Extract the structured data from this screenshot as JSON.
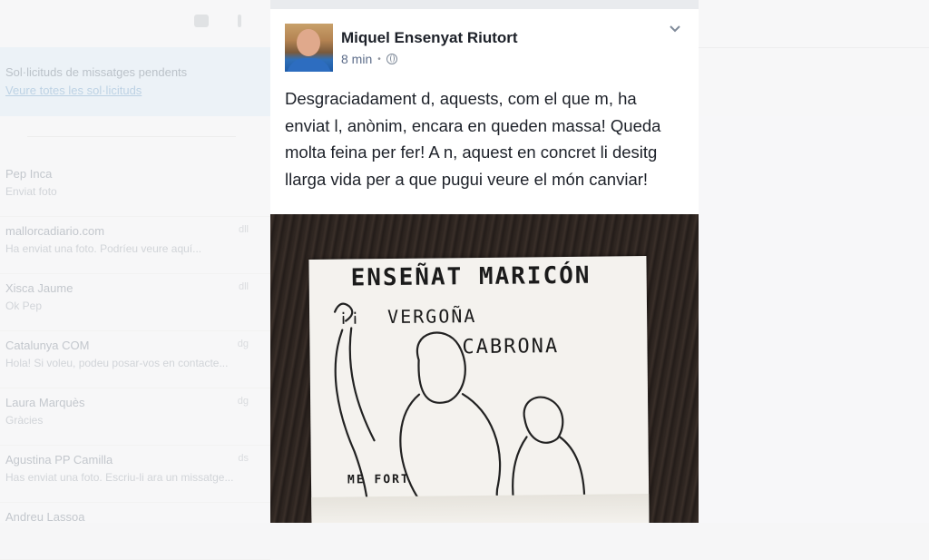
{
  "background": {
    "banner_line1": "Sol·licituds de missatges pendents",
    "banner_line2": "Veure totes les sol·licituds",
    "conversations": [
      {
        "name": "Pep Inca",
        "preview": "Enviat foto",
        "time": ""
      },
      {
        "name": "mallorcadiario.com",
        "preview": "Ha enviat una foto. Podríeu veure aquí...",
        "time": "dll"
      },
      {
        "name": "Xisca Jaume",
        "preview": "Ok Pep",
        "time": "dll"
      },
      {
        "name": "Catalunya COM",
        "preview": "Hola! Si voleu, podeu posar-vos en contacte...",
        "time": "dg"
      },
      {
        "name": "Laura Marquès",
        "preview": "Gràcies",
        "time": "dg"
      },
      {
        "name": "Agustina PP Camilla",
        "preview": "Has enviat una foto. Escriu-li ara un missatge...",
        "time": "ds"
      },
      {
        "name": "Andreu Lassoa",
        "preview": "",
        "time": ""
      }
    ]
  },
  "post": {
    "author": "Miquel Ensenyat Riutort",
    "time": "8 min",
    "separator": "•",
    "text": "Desgraciadament d, aquests, com el que m, ha enviat l, anònim, encara en queden massa! Queda molta feina per fer! A n, aquest en concret li desitg llarga vida per a que pugui veure el món canviar!",
    "photo": {
      "note_line1": "ENSEÑAT MARICÓN",
      "note_line2": "VERGOÑA",
      "note_line3": "CABRONA",
      "note_speech": "¡¡",
      "note_signature": "ME FORT"
    }
  },
  "icons": {
    "privacy": "globe-icon",
    "menu": "chevron-down-icon"
  },
  "colors": {
    "author": "#1d2129",
    "meta": "#5d6d8a",
    "banner": "#e4f0f8"
  }
}
